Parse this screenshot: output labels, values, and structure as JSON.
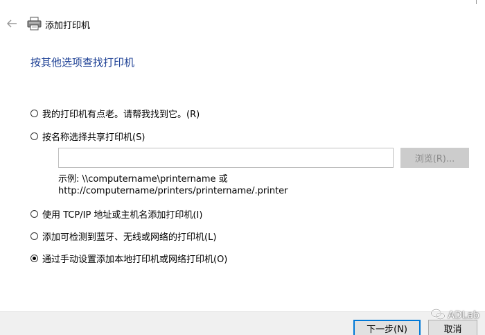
{
  "window": {
    "title": "添加打印机"
  },
  "heading": "按其他选项查找打印机",
  "options": [
    {
      "label": "我的打印机有点老。请帮我找到它。(R)",
      "selected": false
    },
    {
      "label": "按名称选择共享打印机(S)",
      "selected": false
    },
    {
      "label": "使用 TCP/IP 地址或主机名添加打印机(I)",
      "selected": false
    },
    {
      "label": "添加可检测到蓝牙、无线或网络的打印机(L)",
      "selected": false
    },
    {
      "label": "通过手动设置添加本地打印机或网络打印机(O)",
      "selected": true
    }
  ],
  "share": {
    "input_value": "",
    "browse_label": "浏览(R)...",
    "example_line1": "示例: \\\\computername\\printername 或",
    "example_line2": "http://computername/printers/printername/.printer"
  },
  "footer": {
    "next_label": "下一步(N)",
    "cancel_label": "取消"
  },
  "watermark": {
    "text": "ADLab"
  },
  "colors": {
    "heading": "#1c3f94",
    "accent": "#0078d7",
    "footer_bg": "#f0f0f0",
    "disabled_button_bg": "#cccccc"
  },
  "icons": {
    "back": "arrow-left-icon",
    "printer": "printer-icon",
    "watermark": "wechat-icon"
  }
}
